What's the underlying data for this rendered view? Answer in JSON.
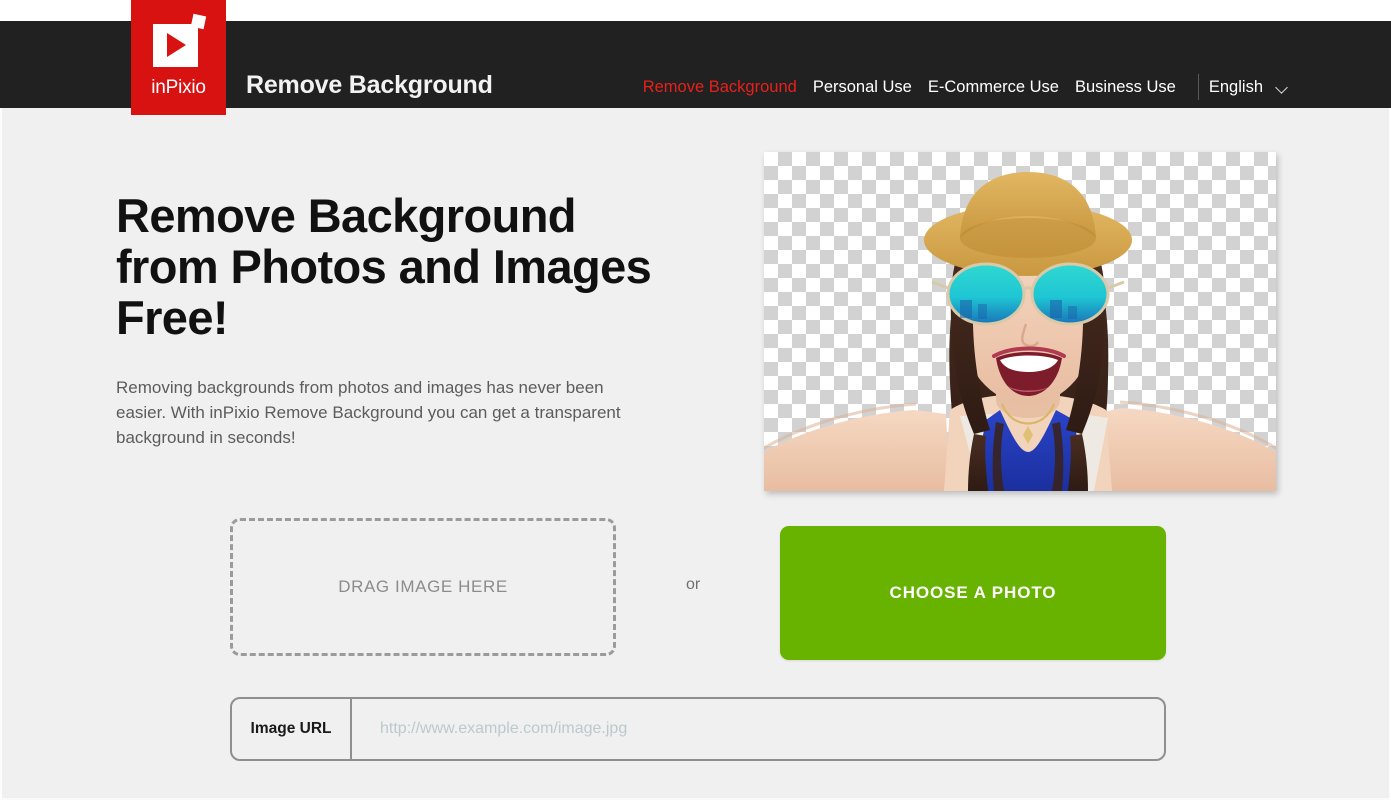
{
  "header": {
    "logo_text": "inPixio",
    "title": "Remove Background",
    "nav": [
      {
        "label": "Remove Background",
        "active": true
      },
      {
        "label": "Personal Use",
        "active": false
      },
      {
        "label": "E-Commerce Use",
        "active": false
      },
      {
        "label": "Business Use",
        "active": false
      }
    ],
    "language": "English",
    "chevron_icon": "chevron-down-icon",
    "background_color": "#212121",
    "accent_color": "#e8201b"
  },
  "hero": {
    "headline": "Remove Background from Photos and Images Free!",
    "subtitle": "Removing backgrounds from photos and images has never been easier. With inPixio Remove Background you can get a transparent background in seconds!",
    "image_alt": "Smiling woman with straw hat and teal mirrored sunglasses on transparent checkerboard background"
  },
  "upload": {
    "dropzone_label": "DRAG IMAGE HERE",
    "or_text": "or",
    "choose_photo_label": "CHOOSE A PHOTO",
    "choose_photo_color": "#68b300"
  },
  "url_field": {
    "label": "Image URL",
    "value": "",
    "placeholder": "http://www.example.com/image.jpg"
  }
}
